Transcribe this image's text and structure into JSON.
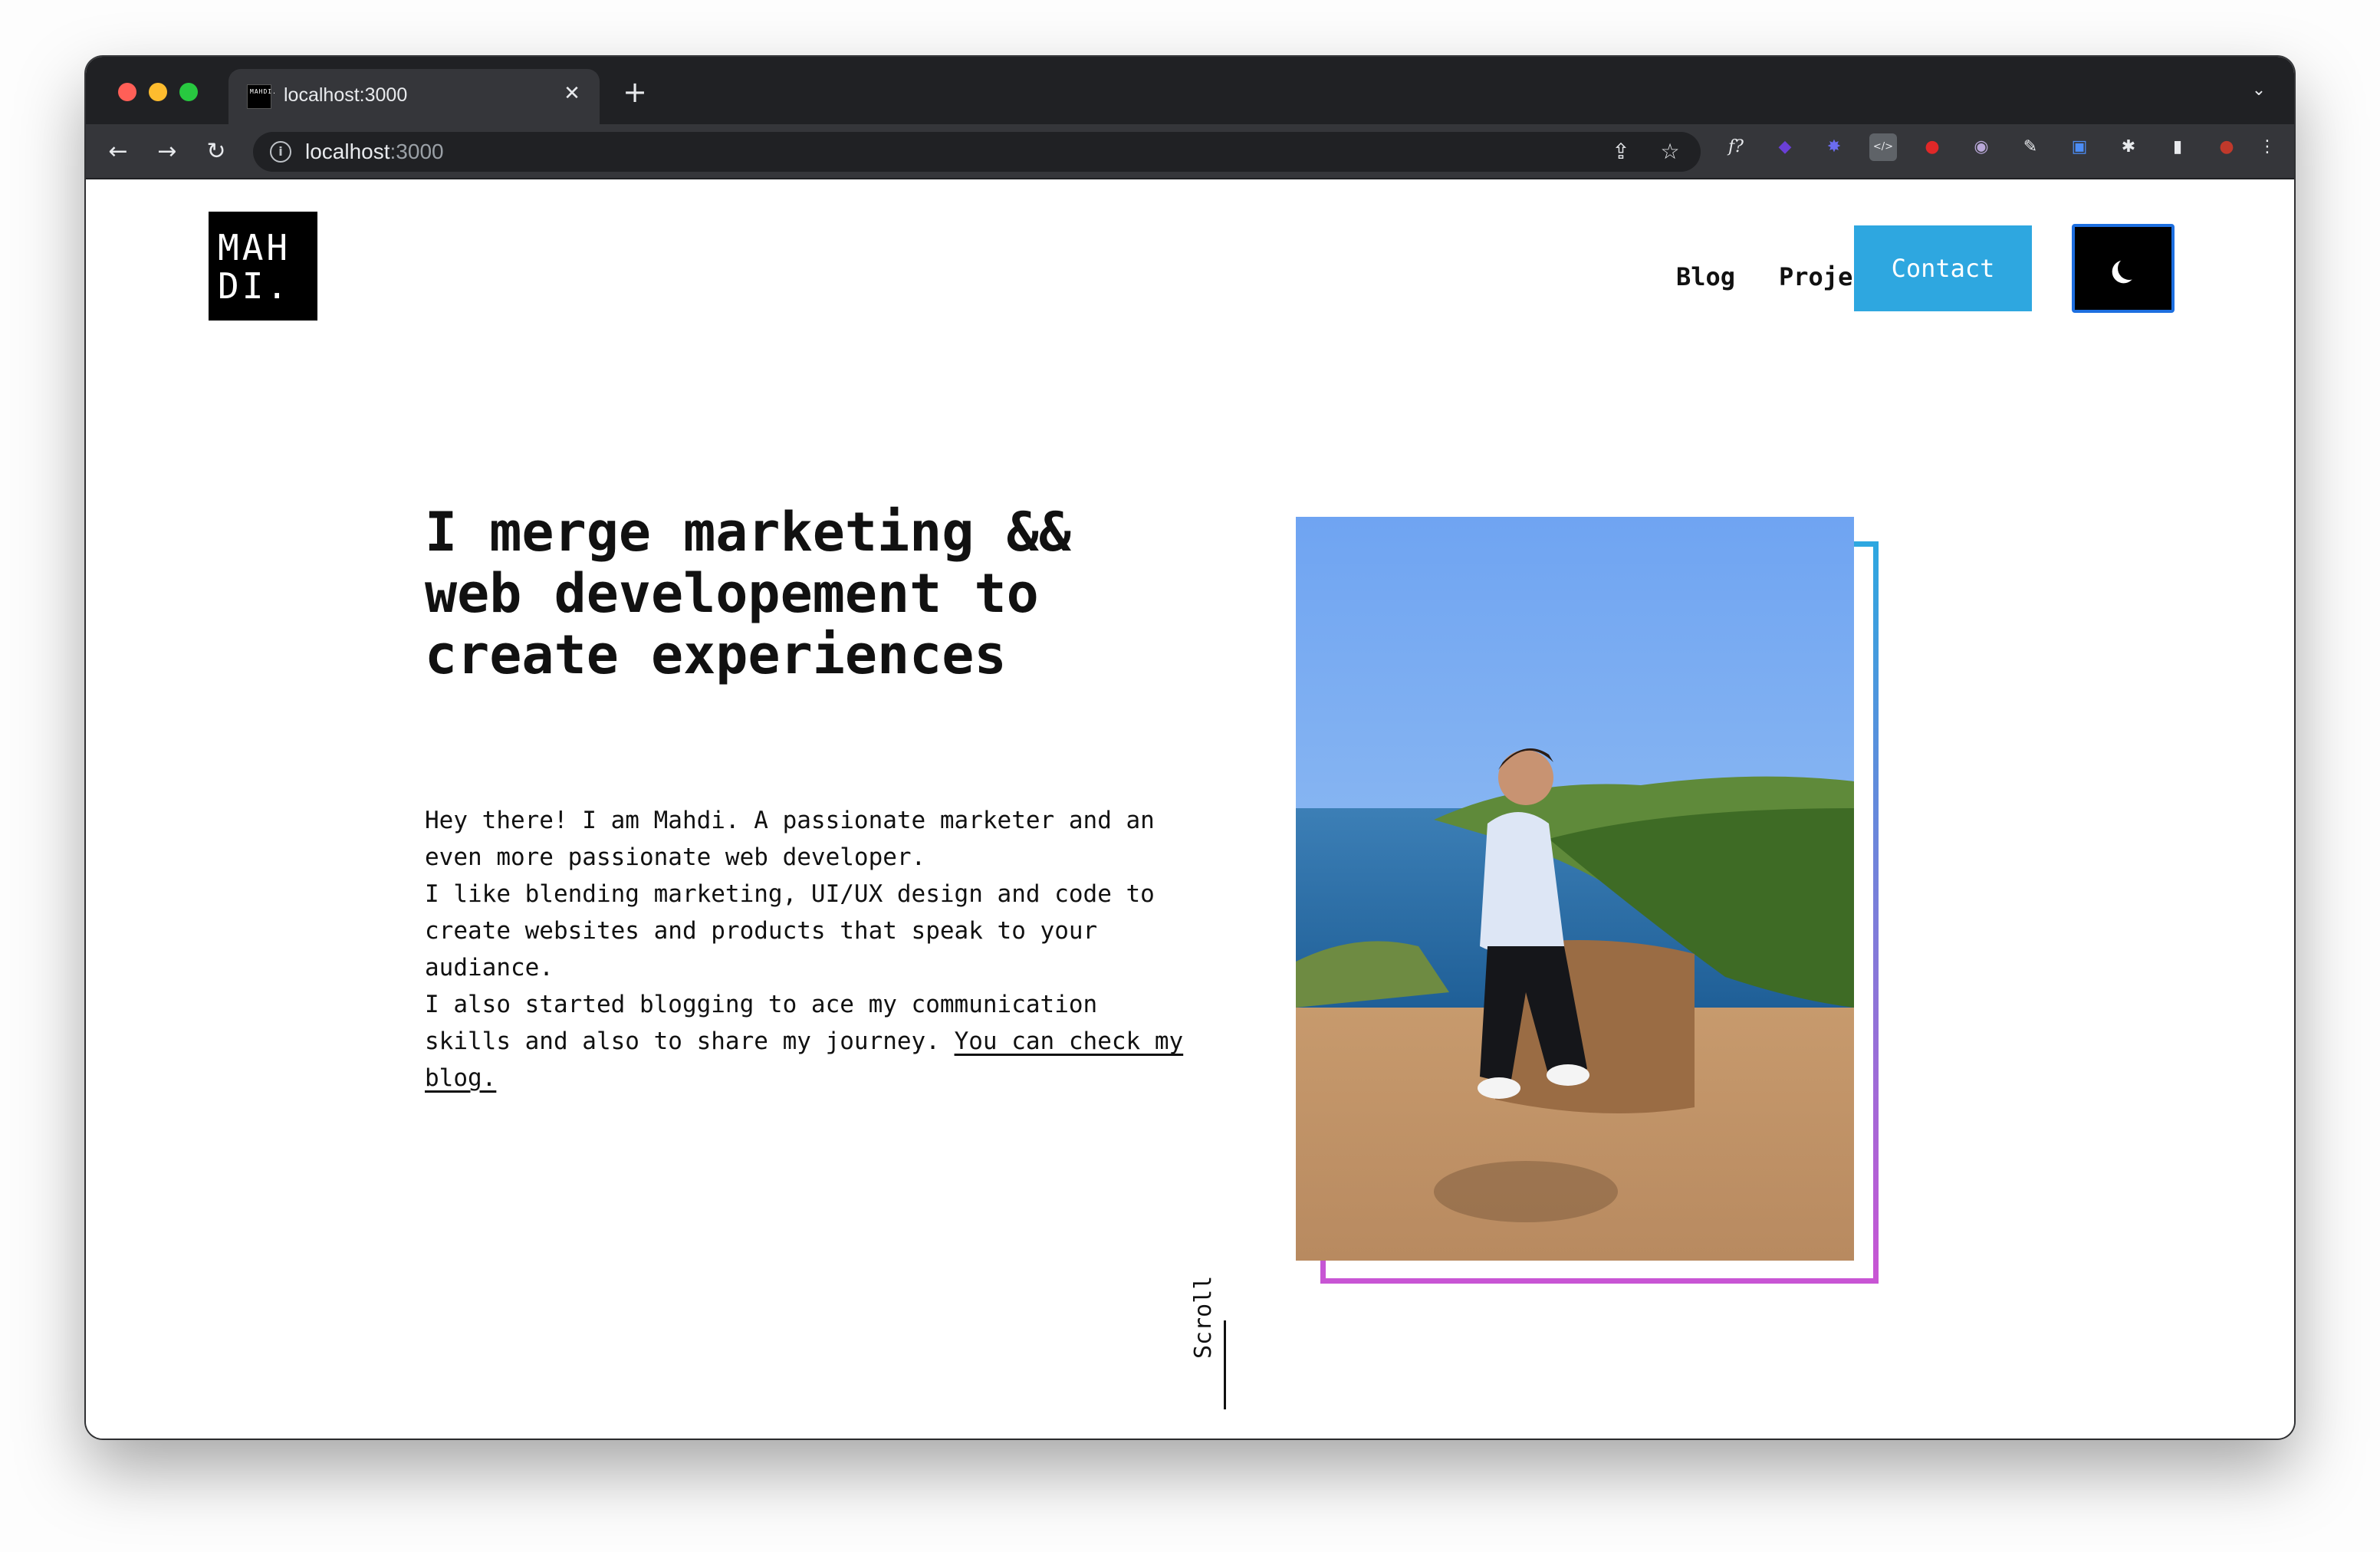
{
  "browser": {
    "tab_title": "localhost:3000",
    "tab_favicon_text": "MAHDI.",
    "url_host": "localhost",
    "url_port": ":3000",
    "close_glyph": "✕",
    "newtab_glyph": "+",
    "menu_glyph": "⌄",
    "back_glyph": "←",
    "forward_glyph": "→",
    "reload_glyph": "↻",
    "info_glyph": "i",
    "share_glyph": "⇪",
    "star_glyph": "☆",
    "extensions": [
      {
        "name": "f-icon",
        "glyph": "f?"
      },
      {
        "name": "purple-ext-icon",
        "glyph": "◆"
      },
      {
        "name": "gear-ext-icon",
        "glyph": "✸"
      },
      {
        "name": "code-ext-icon",
        "glyph": "</>"
      },
      {
        "name": "red-ext-icon",
        "glyph": "●"
      },
      {
        "name": "circle-ext-icon",
        "glyph": "◉"
      },
      {
        "name": "eyedropper-icon",
        "glyph": "✎"
      },
      {
        "name": "blue-ext-icon",
        "glyph": "▣"
      },
      {
        "name": "puzzle-icon",
        "glyph": "✱"
      },
      {
        "name": "sidepanel-icon",
        "glyph": "▮"
      },
      {
        "name": "profile-avatar",
        "glyph": "●"
      },
      {
        "name": "kebab-menu-icon",
        "glyph": "⋮"
      }
    ]
  },
  "site": {
    "logo": [
      "MAH",
      "DI."
    ],
    "nav": {
      "blog": "Blog",
      "projects": "Projects",
      "contact": "Contact"
    },
    "hero": {
      "title": "I merge marketing && web developement to create experiences",
      "paragraph_1": "Hey there! I am Mahdi. A passionate marketer and an even more passionate web developer.",
      "paragraph_2": "I like blending marketing, UI/UX design and code to create websites and products that speak to your audiance.",
      "paragraph_3": "I also started blogging to ace my communication skills and also to share my journey. ",
      "blog_link": "You can check my blog."
    },
    "scroll_label": "Scroll",
    "colors": {
      "accent": "#2ea7e0",
      "gradient_end": "#c855d4",
      "focus_ring": "#1d6fe0"
    }
  }
}
